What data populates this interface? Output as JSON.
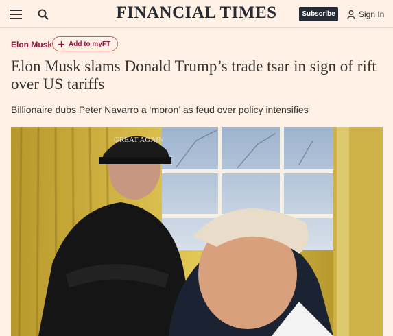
{
  "header": {
    "masthead": "FINANCIAL TIMES",
    "subscribe_label": "Subscribe",
    "signin_label": "Sign In"
  },
  "article": {
    "topic": "Elon Musk",
    "myft_label": "Add to myFT",
    "headline": "Elon Musk slams Donald Trump’s trade tsar in sign of rift over US tariffs",
    "standfirst": "Billionaire dubs Peter Navarro a ‘moron’ as feud over policy intensifies",
    "photo_hat_text": "GREAT AGAIN"
  },
  "colors": {
    "background": "#fff1e5",
    "accent": "#990f3d",
    "dark": "#262a33"
  }
}
